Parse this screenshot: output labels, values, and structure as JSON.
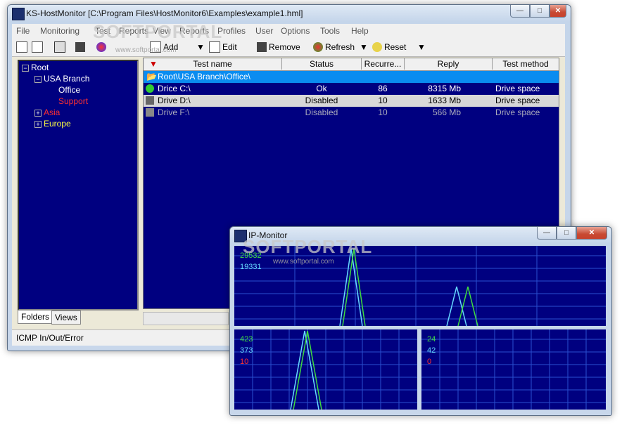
{
  "main_window": {
    "title": "KS-HostMonitor  [C:\\Program Files\\HostMonitor6\\Examples\\example1.hml]",
    "menu": [
      "File",
      "Monitoring",
      "Test",
      "Reports",
      "View",
      "Reports",
      "Profiles",
      "User",
      "Options",
      "Tools",
      "Help"
    ],
    "toolbar": {
      "add": "Add",
      "edit": "Edit",
      "remove": "Remove",
      "refresh": "Refresh",
      "reset": "Reset"
    },
    "tree": {
      "root": "Root",
      "usa": "USA Branch",
      "office": "Office",
      "support": "Support",
      "asia": "Asia",
      "europe": "Europe"
    },
    "tabs": {
      "folders": "Folders",
      "views": "Views"
    },
    "columns": [
      "Test name",
      "Status",
      "Recurre...",
      "Reply",
      "Test method"
    ],
    "path_row": "Root\\USA Branch\\Office\\",
    "rows": [
      {
        "name": "Drice C:\\",
        "status": "Ok",
        "recurrence": "86",
        "reply": "8315 Mb",
        "method": "Drive space"
      },
      {
        "name": "Drive D:\\",
        "status": "Disabled",
        "recurrence": "10",
        "reply": "1633 Mb",
        "method": "Drive space"
      },
      {
        "name": "Drive F:\\",
        "status": "Disabled",
        "recurrence": "10",
        "reply": "566 Mb",
        "method": "Drive space"
      }
    ],
    "status_text": "ICMP In/Out/Error"
  },
  "ip_window": {
    "title": "IP-Monitor",
    "top": {
      "v1": "29532",
      "v2": "19331"
    },
    "bottom_left": {
      "v1": "423",
      "v2": "373",
      "v3": "10"
    },
    "bottom_right": {
      "v1": "24",
      "v2": "42",
      "v3": "0"
    }
  },
  "watermark": {
    "main": "SOFTPORTAL",
    "sub": "www.softportal.com"
  },
  "colors": {
    "panel_bg": "#000080",
    "grid": "#2a4fcf",
    "green": "#3fdc3f",
    "cyan": "#66d9ff",
    "red": "#ff3030",
    "highlight": "#0a8cf0"
  }
}
